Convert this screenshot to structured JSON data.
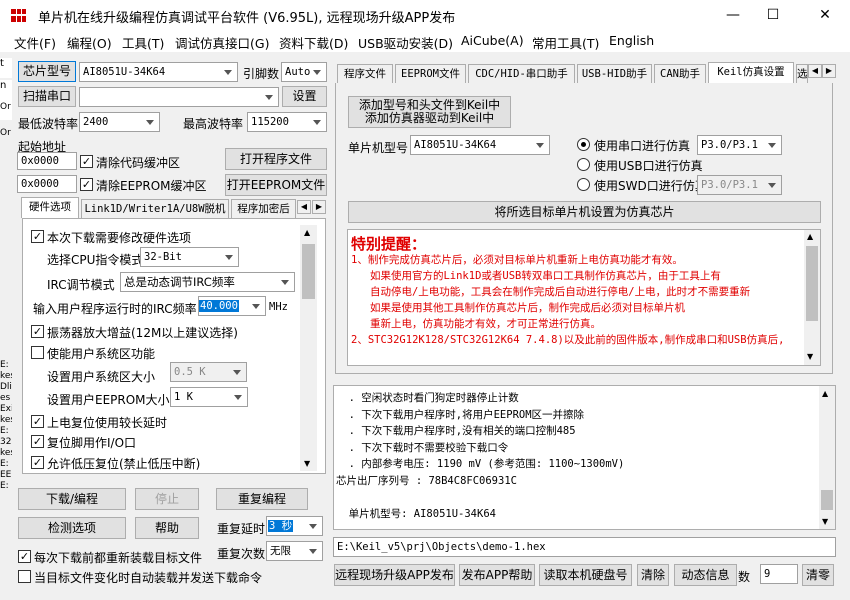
{
  "window": {
    "title": "单片机在线升级编程仿真调试平台软件 (V6.95L), 远程现场升级APP发布",
    "min": "—",
    "max": "☐",
    "close": "✕"
  },
  "menu": [
    "文件(F)",
    "编程(O)",
    "工具(T)",
    "调试仿真接口(G)",
    "资料下载(D)",
    "USB驱动安装(D)",
    "AiCube(A)",
    "常用工具(T)",
    "English"
  ],
  "left": {
    "chip_button": "芯片型号",
    "chip_value": "AI8051U-34K64",
    "pins_label": "引脚数",
    "pins_value": "Auto",
    "scan_button": "扫描串口",
    "port_value": "",
    "settings_button": "设置",
    "min_baud_label": "最低波特率",
    "min_baud": "2400",
    "max_baud_label": "最高波特率",
    "max_baud": "115200",
    "start_addr_label": "起始地址",
    "addr1": "0x0000",
    "clear_code": "清除代码缓冲区",
    "open_program": "打开程序文件",
    "addr2": "0x0000",
    "clear_eeprom": "清除EEPROM缓冲区",
    "open_eeprom": "打开EEPROM文件",
    "tabs": [
      "硬件选项",
      "Link1D/Writer1A/U8W脱机",
      "程序加密后"
    ],
    "hw": {
      "modify_hw": "本次下载需要修改硬件选项",
      "cpu_mode_label": "选择CPU指令模式",
      "cpu_mode": "32-Bit",
      "irc_label": "IRC调节模式",
      "irc_mode": "总是动态调节IRC频率",
      "freq_label": "输入用户程序运行时的IRC频率",
      "freq_value": "40.000",
      "freq_unit": "MHz",
      "osc_gain": "振荡器放大增益(12M以上建议选择)",
      "enable_sys": "使能用户系统区功能",
      "sys_size_label": "设置用户系统区大小",
      "sys_size": "0.5 K",
      "eeprom_size_label": "设置用户EEPROM大小",
      "eeprom_size": "1   K",
      "power_reset": "上电复位使用较长延时",
      "reset_io": "复位脚用作I/O口",
      "low_volt": "允许低压复位(禁止低压中断)"
    },
    "download_button": "下载/编程",
    "stop_button": "停止",
    "repeat_button": "重复编程",
    "detect_button": "检测选项",
    "help_button": "帮助",
    "repeat_delay_label": "重复延时",
    "repeat_delay": "3 秒",
    "repeat_count_label": "重复次数",
    "repeat_count": "无限",
    "reload_each": "每次下载前都重新装载目标文件",
    "auto_send": "当目标文件变化时自动装载并发送下载命令"
  },
  "right": {
    "tabs": [
      "程序文件",
      "EEPROM文件",
      "CDC/HID-串口助手",
      "USB-HID助手",
      "CAN助手",
      "Keil仿真设置",
      "选"
    ],
    "keil": {
      "add_button": "添加型号和头文件到Keil中\n添加仿真器驱动到Keil中",
      "mcu_label": "单片机型号",
      "mcu_value": "AI8051U-34K64",
      "serial_radio": "使用串口进行仿真",
      "serial_port": "P3.0/P3.1",
      "usb_radio": "使用USB口进行仿真",
      "swd_radio": "使用SWD口进行仿真",
      "swd_port": "P3.0/P3.1",
      "set_button": "将所选目标单片机设置为仿真芯片",
      "notice_title": "特别提醒：",
      "notice": [
        "1、制作完成仿真芯片后，必须对目标单片机重新上电仿真功能才有效。",
        "   如果使用官方的Link1D或者USB转双串口工具制作仿真芯片，由于工具上有",
        "   自动停电/上电功能，工具会在制作完成后自动进行停电/上电，此时才不需要重新",
        "   如果是使用其他工具制作仿真芯片后，制作完成后必须对目标单片机",
        "   重新上电，仿真功能才有效，才可正常进行仿真。",
        "2、STC32G12K128/STC32G12K64  7.4.8)以及此前的固件版本,制作成串口和USB仿真后,"
      ]
    },
    "log": [
      "  . 空闲状态时看门狗定时器停止计数",
      "  . 下次下载用户程序时,将用户EEPROM区一并擦除",
      "  . 下次下载用户程序时,没有相关的端口控制485",
      "  . 下次下载时不需要校验下载口令",
      "  . 内部参考电压: 1190 mV (参考范围: 1100~1300mV)",
      "芯片出厂序列号 : 78B4C8FC06931C",
      "",
      "  单片机型号: AI8051U-34K64"
    ],
    "path": "E:\\Keil_v5\\prj\\Objects\\demo-1.hex",
    "bottom": {
      "remote": "远程现场升级APP发布",
      "publish_help": "发布APP帮助",
      "read_disk": "读取本机硬盘号",
      "clear": "清除",
      "dynamic": "动态信息",
      "count_label": "数",
      "count": "9",
      "clear_count": "清零"
    }
  },
  "behind": {
    "top_letters": [
      "t",
      "n",
      "Or",
      "Or"
    ],
    "side_letters": [
      "E:",
      "kes",
      "Dlir",
      "es",
      "Exi",
      "kes",
      "E:",
      "32",
      "kes",
      "E:",
      "EEP",
      "E:"
    ]
  }
}
